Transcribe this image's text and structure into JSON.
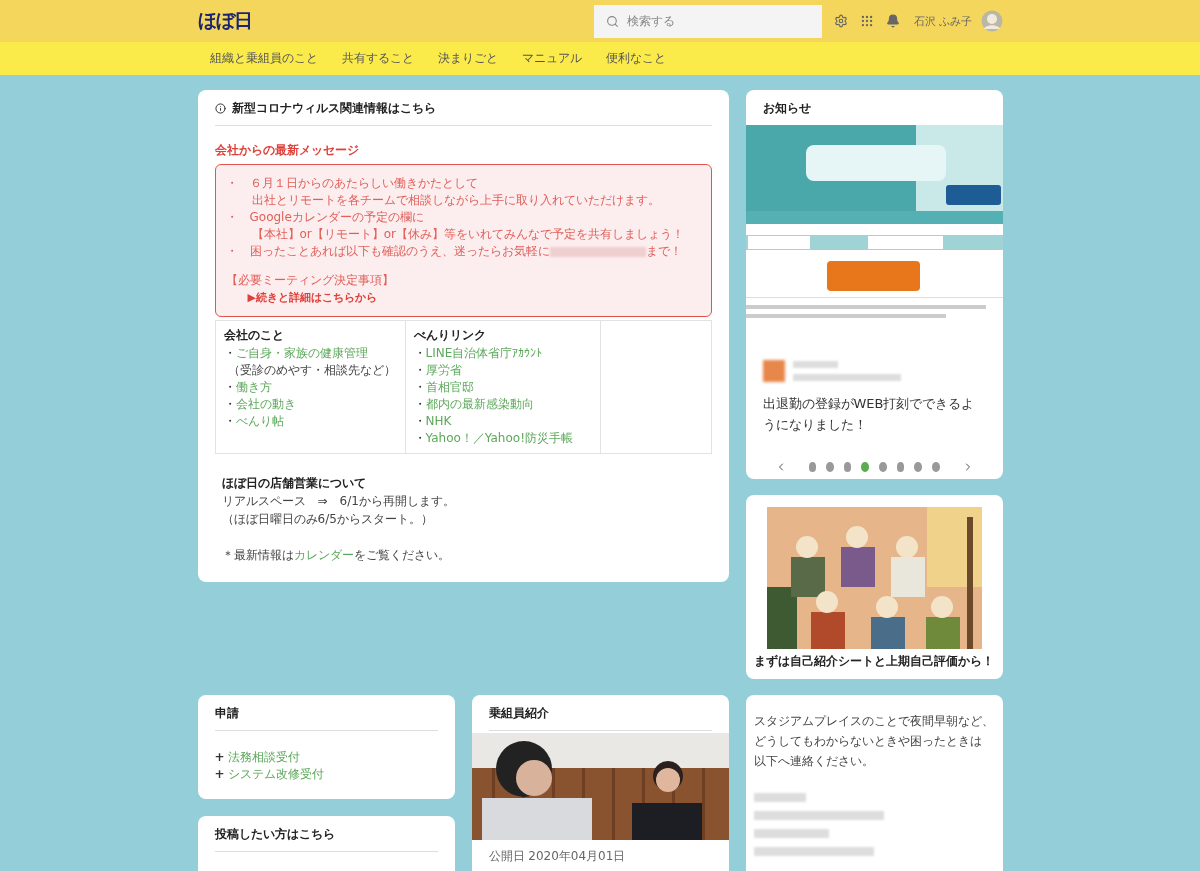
{
  "header": {
    "logo": "ほぼ日",
    "search": {
      "placeholder": "検索する"
    },
    "user_name": "石沢 ふみ子"
  },
  "nav": [
    {
      "label": "組織と乗組員のこと"
    },
    {
      "label": "共有すること"
    },
    {
      "label": "決まりごと"
    },
    {
      "label": "マニュアル"
    },
    {
      "label": "便利なこと"
    }
  ],
  "news_card": {
    "title": "新型コロナウィルス関連情報はこちら",
    "message_heading": "会社からの最新メッセージ",
    "message_lines": [
      {
        "kind": "bullet",
        "marker": "・",
        "text": "６月１日からのあたらしい働きかたとして"
      },
      {
        "kind": "continuation",
        "text": "出社とリモートを各チームで相談しながら上手に取り入れていただけます。"
      },
      {
        "kind": "bullet",
        "marker": "・",
        "text": "Googleカレンダーの予定の欄に"
      },
      {
        "kind": "continuation",
        "text": "【本社】or【リモート】or【休み】等をいれてみんなで予定を共有しましょう！"
      },
      {
        "kind": "redacted",
        "marker": "・",
        "text": "困ったことあれば以下も確認のうえ、迷ったらお気軽に",
        "after": "まで！"
      }
    ],
    "meeting_heading": "【必要ミーティング決定事項】",
    "meeting_link": "▶続きと詳細はこちらから",
    "link_columns": [
      {
        "title": "会社のこと",
        "items": [
          {
            "kind": "link",
            "marker": "・",
            "text": "ご自身・家族の健康管理"
          },
          {
            "kind": "note",
            "text": "（受診のめやす・相談先など）"
          },
          {
            "kind": "link",
            "marker": "・",
            "text": "働き方"
          },
          {
            "kind": "link",
            "marker": "・",
            "text": "会社の動き"
          },
          {
            "kind": "link",
            "marker": "・",
            "text": "べんり帖"
          }
        ]
      },
      {
        "title": "べんりリンク",
        "items": [
          {
            "kind": "link",
            "marker": "・",
            "text": "LINE自治体省庁ｱｶｳﾝﾄ"
          },
          {
            "kind": "link",
            "marker": "・",
            "text": "厚労省"
          },
          {
            "kind": "link",
            "marker": "・",
            "text": "首相官邸"
          },
          {
            "kind": "link",
            "marker": "・",
            "text": "都内の最新感染動向"
          },
          {
            "kind": "link",
            "marker": "・",
            "text": "NHK"
          },
          {
            "kind": "links",
            "marker": "・",
            "parts": [
              "Yahoo！",
              "Yahoo!防災手帳"
            ],
            "separator": "／"
          }
        ]
      }
    ],
    "store": {
      "title": "ほぼ日の店舗営業について",
      "lines": [
        "リアルスペース　⇒　6/1から再開します。",
        "（ほぼ日曜日のみ6/5からスタート。）"
      ],
      "note_before": "＊最新情報は",
      "note_link": "カレンダー",
      "note_after": "をご覧ください。"
    }
  },
  "notice_card": {
    "title": "お知らせ",
    "text": "出退勤の登録がWEB打刻でできるようになりました！",
    "dots": [
      {
        "selected": false
      },
      {
        "selected": false
      },
      {
        "selected": false
      },
      {
        "selected": true
      },
      {
        "selected": false
      },
      {
        "selected": false
      },
      {
        "selected": false
      },
      {
        "selected": false
      }
    ]
  },
  "banner_card": {
    "caption": "まずは自己紹介シートと上期自己評価から！"
  },
  "apply_card": {
    "title": "申請",
    "items": [
      {
        "marker": "+",
        "text": "法務相談受付"
      },
      {
        "marker": "+",
        "text": "システム改修受付"
      }
    ]
  },
  "post_card": {
    "title": "投稿したい方はこちら"
  },
  "crew_card": {
    "title": "乗組員紹介",
    "date": "公開日 2020年04月01日"
  },
  "contact_card": {
    "lines": [
      "スタジアムプレイスのことで夜間早朝など、",
      "どうしてもわからないときや困ったときは",
      "以下へ連絡ください。"
    ]
  }
}
